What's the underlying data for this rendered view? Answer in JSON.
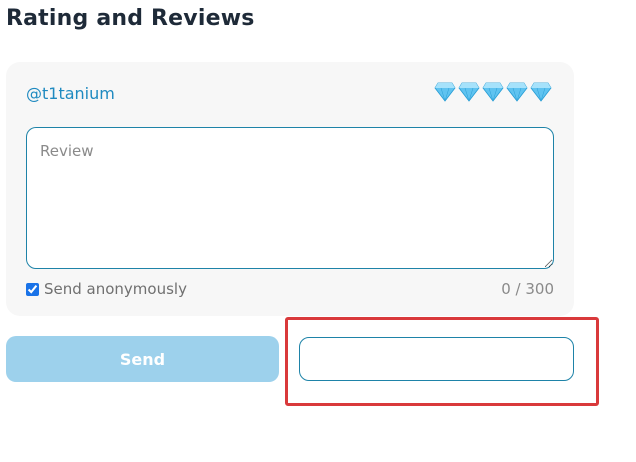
{
  "page": {
    "title": "Rating and Reviews"
  },
  "review_form": {
    "username": "@t1tanium",
    "rating": {
      "icon": "gem-icon",
      "count": 5,
      "gem_color": "#5fc3f0"
    },
    "review_placeholder": "Review",
    "review_value": "",
    "anonymous_label": "Send anonymously",
    "anonymous_checked": true,
    "char_count": "0 / 300"
  },
  "actions": {
    "send_label": "Send",
    "send_color": "#9dd1ec",
    "secondary_label": ""
  },
  "annotation": {
    "highlight_color": "#d9393b"
  }
}
